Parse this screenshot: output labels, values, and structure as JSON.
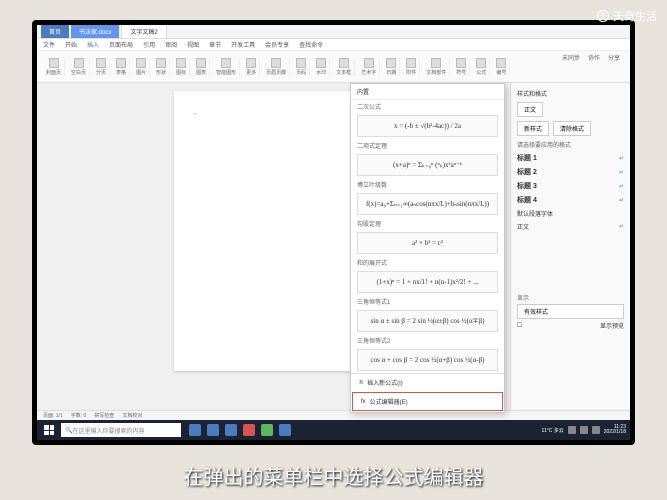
{
  "watermark": "天奇生活",
  "subtitle": "在弹出的菜单栏中选择公式编辑器",
  "tabs": {
    "home": "首页",
    "doc": "书法家.docx",
    "blank": "文字文稿2"
  },
  "menu": {
    "file": "文件",
    "start": "开始",
    "insert": "插入",
    "page": "页面布局",
    "ref": "引用",
    "review": "审阅",
    "view": "视图",
    "section": "章节",
    "dev": "开发工具",
    "special": "会员专享",
    "find": "查找命令"
  },
  "tools": {
    "cover": "封面页",
    "blank": "空白页",
    "break": "分页",
    "table": "表格",
    "pic": "图片",
    "shape": "形状",
    "icon": "图标",
    "chart": "图表",
    "smart": "智能图形",
    "flow": "流程图",
    "mind": "思维导图",
    "more": "更多",
    "screen": "截屏",
    "obj": "对象",
    "art": "艺术字",
    "date": "日期",
    "attach": "附件",
    "field": "文档部件",
    "symbol": "符号",
    "eq": "公式",
    "num": "编号",
    "head": "页眉页脚",
    "pnum": "页码",
    "wm": "水印",
    "text": "文本框"
  },
  "topright": {
    "undo": "未同步",
    "coop": "协作",
    "share": "分享"
  },
  "dropdown": {
    "header": "内置",
    "sec1": "二次公式",
    "f1": "x = (-b ± √(b²-4ac)) / 2a",
    "sec2": "二项式定理",
    "f2": "(x+a)ⁿ = Σₖ₌₀ⁿ (ⁿₖ)xᵏaⁿ⁻ᵏ",
    "sec3": "傅立叶级数",
    "f3": "f(x)=a₀+Σₙ₌₁∞(aₙcos(nπx/L)+bₙsin(nπx/L))",
    "sec4": "勾股定理",
    "f4": "a² + b² = c²",
    "sec5": "和的展开式",
    "f5": "(1+x)ⁿ = 1 + nx/1! + n(n-1)x²/2! + ...",
    "sec6": "三角恒等式1",
    "f6": "sin α ± sin β = 2 sin ½(α±β) cos ½(α∓β)",
    "sec7": "三角恒等式2",
    "f7": "cos α + cos β = 2 cos ½(α+β) cos ½(α-β)",
    "item1": "插入新公式(I)",
    "item2": "公式编辑器(E)"
  },
  "panel": {
    "title": "样式和格式",
    "normal": "正文",
    "new": "新样式",
    "clear": "清除格式",
    "sub": "请选择要应用的格式",
    "h1": "标题 1",
    "h2": "标题 2",
    "h3": "标题 3",
    "h4": "标题 4",
    "default": "默认段落字体",
    "body": "正文",
    "show": "显示",
    "valid": "有效样式",
    "preview": "显示预览"
  },
  "status": {
    "page": "页面: 1/1",
    "words": "字数: 0",
    "spell": "拼写检查",
    "proof": "文档校对"
  },
  "taskbar": {
    "search": "在这里输入你要搜索的内容",
    "temp": "11°C 多云",
    "time": "11:23",
    "date": "2022/1/18"
  }
}
